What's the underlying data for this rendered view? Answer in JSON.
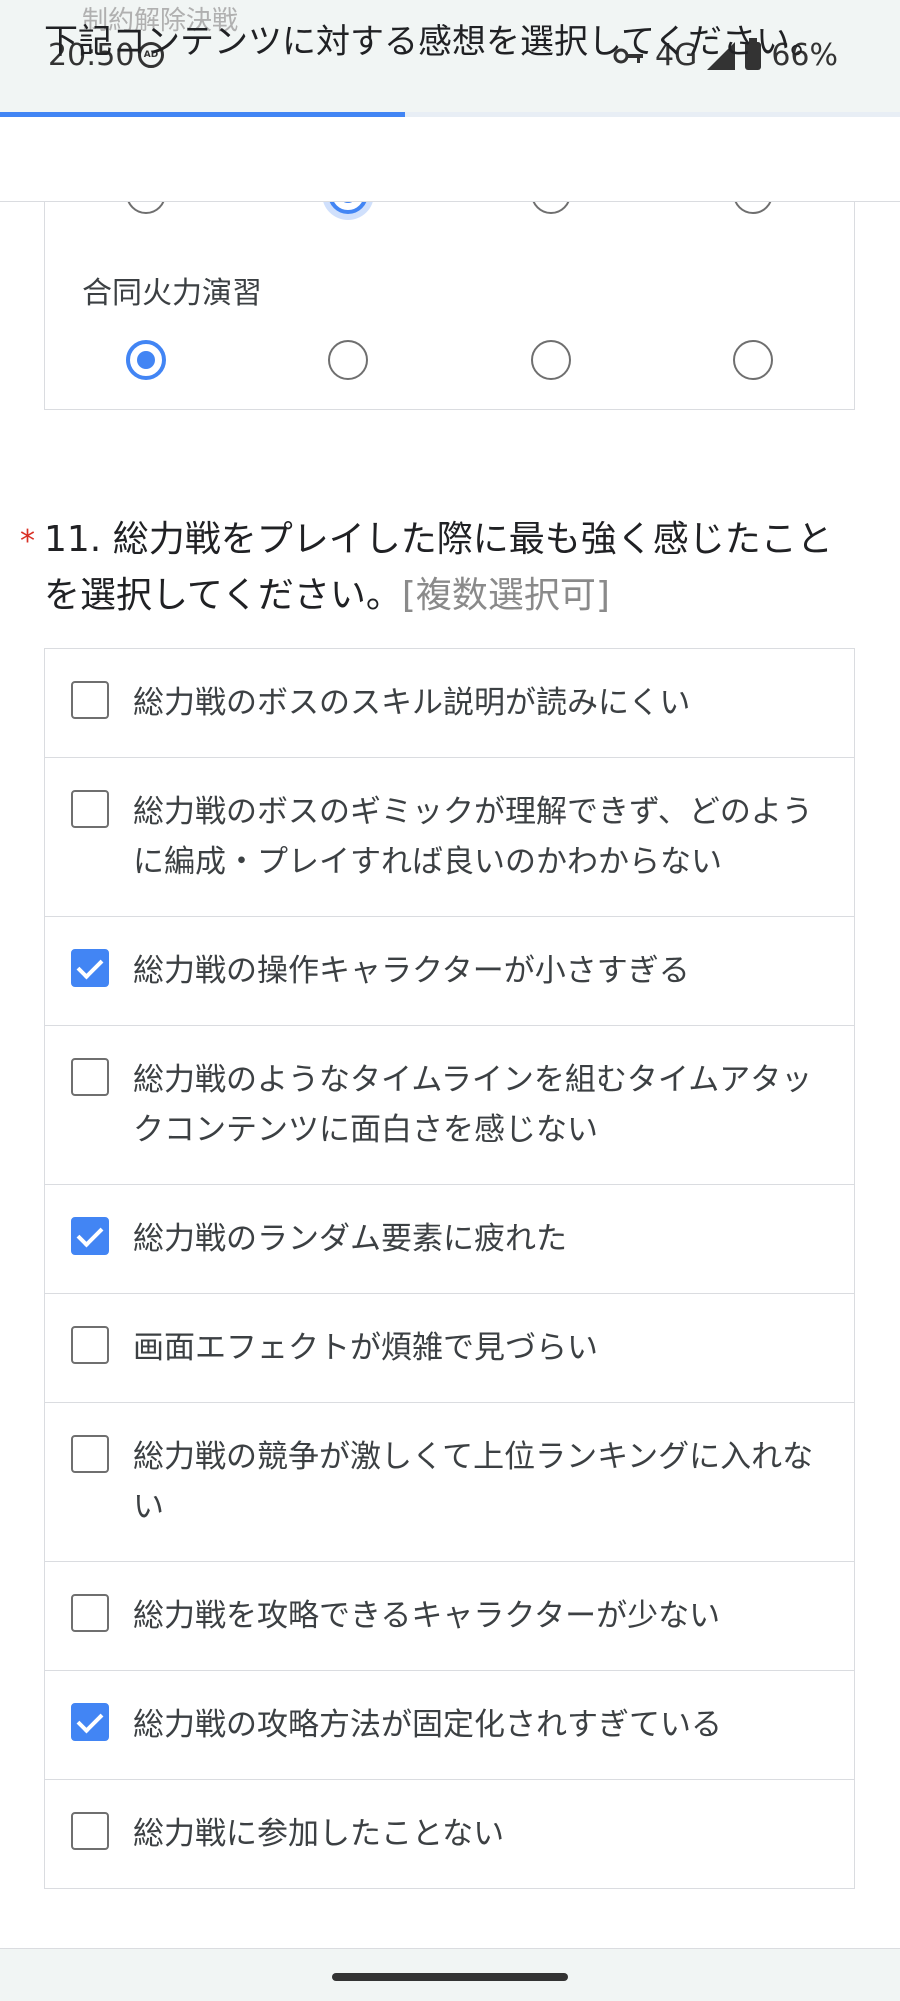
{
  "status_bar": {
    "time": "20:50",
    "network": "4G",
    "battery": "66%",
    "icons": [
      "adblock-icon",
      "vpn-key-icon",
      "signal-icon",
      "battery-icon"
    ]
  },
  "form_progress": 0.45,
  "accent_color": "#4285f4",
  "grid_question": {
    "sticky_title": "下記コンテンツに対する感想を選択してください。",
    "rows": [
      {
        "label": "制約解除決戦",
        "selected_index": 1
      },
      {
        "label": "合同火力演習",
        "selected_index": 0
      }
    ],
    "column_count": 4
  },
  "question": {
    "required_mark": "*",
    "title": "11. 総力戦をプレイした際に最も強く感じたことを選択してください。",
    "hint": "[複数選択可]",
    "options": [
      {
        "label": "総力戦のボスのスキル説明が読みにくい",
        "checked": false
      },
      {
        "label": "総力戦のボスのギミックが理解できず、どのように編成・プレイすれば良いのかわからない",
        "checked": false
      },
      {
        "label": "総力戦の操作キャラクターが小さすぎる",
        "checked": true
      },
      {
        "label": "総力戦のようなタイムラインを組むタイムアタックコンテンツに面白さを感じない",
        "checked": false
      },
      {
        "label": "総力戦のランダム要素に疲れた",
        "checked": true
      },
      {
        "label": "画面エフェクトが煩雑で見づらい",
        "checked": false
      },
      {
        "label": "総力戦の競争が激しくて上位ランキングに入れない",
        "checked": false
      },
      {
        "label": "総力戦を攻略できるキャラクターが少ない",
        "checked": false
      },
      {
        "label": "総力戦の攻略方法が固定化されすぎている",
        "checked": true
      },
      {
        "label": "総力戦に参加したことない",
        "checked": false
      }
    ]
  }
}
